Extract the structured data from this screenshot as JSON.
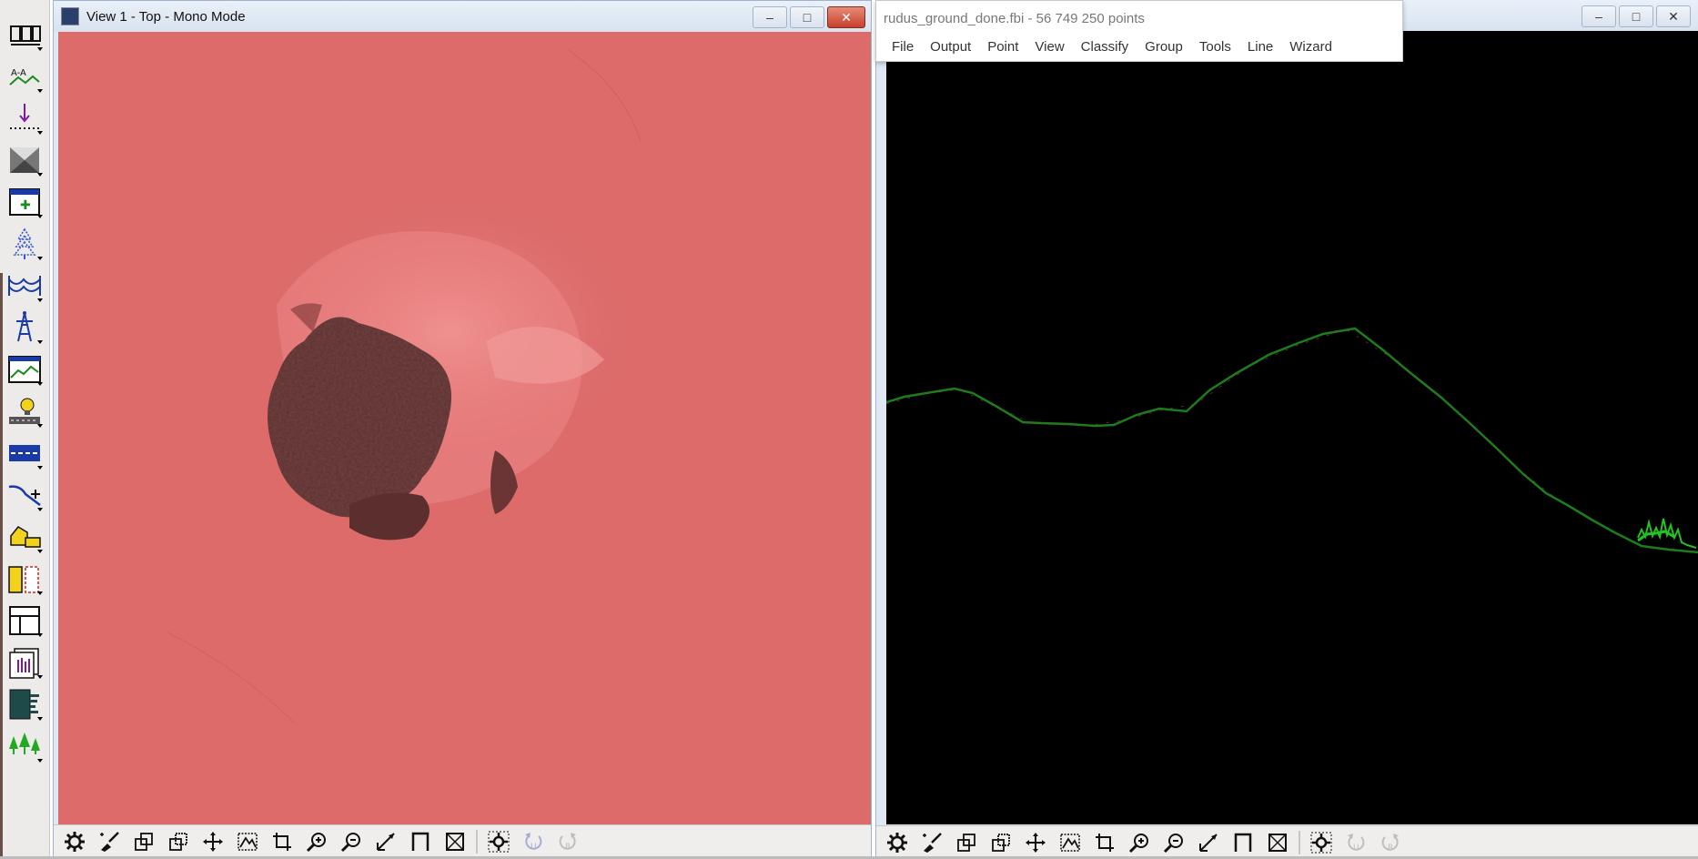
{
  "view1": {
    "title": "View 1 - Top - Mono Mode",
    "window_buttons": {
      "minimize": "–",
      "maximize": "□",
      "close": "✕"
    }
  },
  "main_window": {
    "title": "rudus_ground_done.fbi - 56 749 250 points",
    "menu": [
      "File",
      "Output",
      "Point",
      "View",
      "Classify",
      "Group",
      "Tools",
      "Line",
      "Wizard"
    ]
  },
  "view2": {
    "window_buttons": {
      "minimize": "–",
      "maximize": "□",
      "close": "✕"
    }
  },
  "left_toolbar": {
    "tools": [
      "draw-mode-icon",
      "section-icon",
      "drop-point-icon",
      "image-icon",
      "view-icon",
      "tree-icon",
      "wire-icon",
      "tower-icon",
      "profile-icon",
      "lamp-icon",
      "road-icon",
      "vector-icon",
      "building-icon",
      "compare-icon",
      "layout-icon",
      "report-icon",
      "histogram-icon",
      "forest-icon"
    ]
  },
  "bottom_toolbar": {
    "tools": [
      "settings-icon",
      "brush-icon",
      "copy-view-icon",
      "copy-view2-icon",
      "pan-icon",
      "fit-icon",
      "crop-icon",
      "zoom-in-icon",
      "zoom-out-icon",
      "measure-icon",
      "section-box-icon",
      "box-icon",
      "sync-icon",
      "undo-icon",
      "redo-icon"
    ]
  },
  "colors": {
    "raster": "#dc6b6a",
    "profile_line": "#1b7d1b",
    "vegetation": "#22c322",
    "view_background": "#000000"
  }
}
